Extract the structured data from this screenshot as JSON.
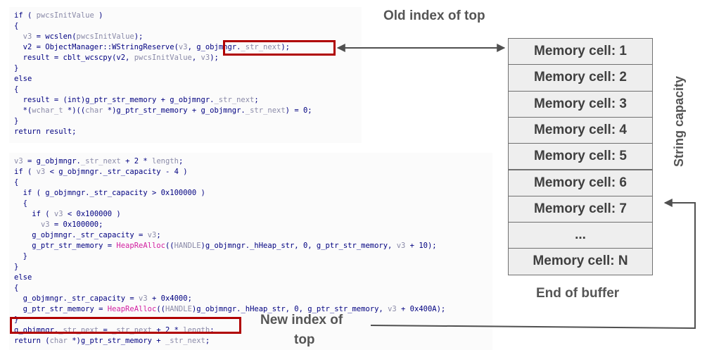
{
  "code_top": [
    "if ( pwcsInitValue )",
    "{",
    "  v3 = wcslen(pwcsInitValue);",
    "  v2 = ObjectManager::WStringReserve(v3, g_objmngr._str_next);",
    "  result = cblt_wcscpy(v2, pwcsInitValue, v3);",
    "}",
    "else",
    "{",
    "  result = (int)g_ptr_str_memory + g_objmngr._str_next;",
    "  *(wchar_t *)((char *)g_ptr_str_memory + g_objmngr._str_next) = 0;",
    "}",
    "return result;"
  ],
  "code_bottom": [
    "v3 = g_objmngr._str_next + 2 * length;",
    "if ( v3 < g_objmngr._str_capacity - 4 )",
    "{",
    "  if ( g_objmngr._str_capacity > 0x100000 )",
    "  {",
    "    if ( v3 < 0x100000 )",
    "      v3 = 0x100000;",
    "    g_objmngr._str_capacity = v3;",
    "    g_ptr_str_memory = HeapReAlloc((HANDLE)g_objmngr._hHeap_str, 0, g_ptr_str_memory, v3 + 10);",
    "  }",
    "}",
    "else",
    "{",
    "  g_objmngr._str_capacity = v3 + 0x4000;",
    "  g_ptr_str_memory = HeapReAlloc((HANDLE)g_objmngr._hHeap_str, 0, g_ptr_str_memory, v3 + 0x400A);",
    "}",
    "g_objmngr._str_next = _str_next + 2 * length;",
    "return (char *)g_ptr_str_memory + _str_next;"
  ],
  "labels": {
    "old_index": "Old index of top",
    "new_index_line1": "New index of",
    "new_index_line2": "top",
    "end_of_buffer": "End of buffer",
    "string_capacity": "String capacity"
  },
  "memory_cells": [
    "Memory cell: 1",
    "Memory cell: 2",
    "Memory cell: 3",
    "Memory cell: 4",
    "Memory cell: 5",
    "Memory cell: 6",
    "Memory cell: 7",
    "...",
    "Memory cell: N"
  ],
  "colors": {
    "highlight_border": "#b00000",
    "cell_fill": "#eeeeee",
    "label_text": "#555555",
    "arrow": "#505050"
  }
}
